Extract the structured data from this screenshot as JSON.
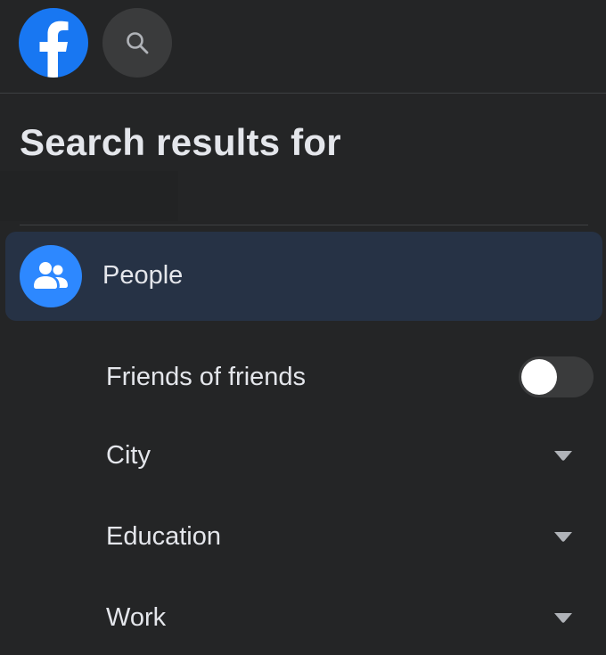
{
  "header": {
    "logo_icon": "facebook-logo-icon",
    "search_icon": "search-icon"
  },
  "title": "Search results for",
  "people": {
    "label": "People",
    "icon": "people-icon"
  },
  "filters": [
    {
      "label": "Friends of friends",
      "control": "toggle",
      "on": false
    },
    {
      "label": "City",
      "control": "dropdown"
    },
    {
      "label": "Education",
      "control": "dropdown"
    },
    {
      "label": "Work",
      "control": "dropdown"
    }
  ],
  "colors": {
    "background": "#242526",
    "brand_blue": "#1877f2",
    "selected_row": "#263245",
    "text": "#e4e6eb"
  }
}
